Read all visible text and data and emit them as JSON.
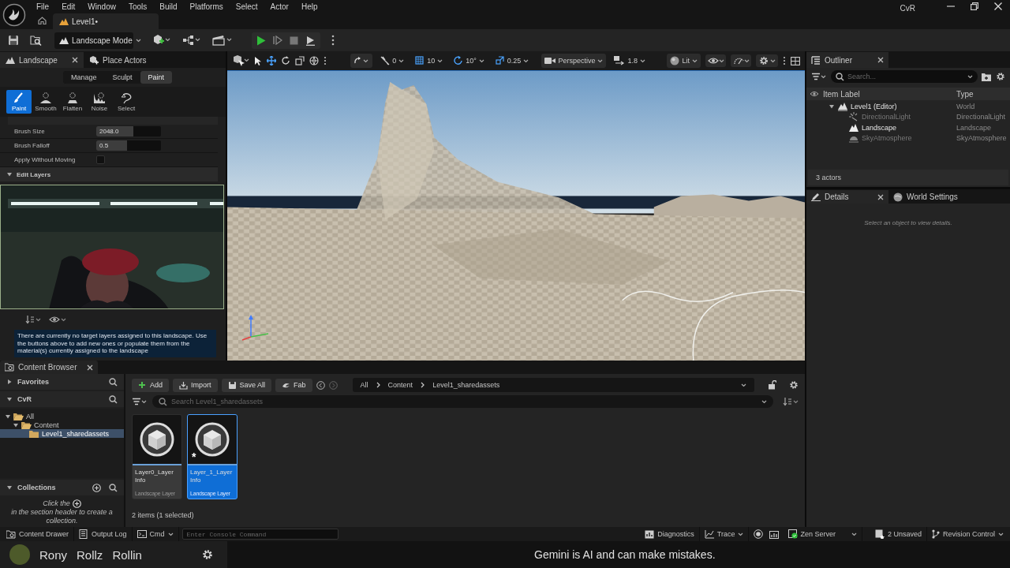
{
  "menu": [
    "File",
    "Edit",
    "Window",
    "Tools",
    "Build",
    "Platforms",
    "Select",
    "Actor",
    "Help"
  ],
  "project_name": "CvR",
  "level_tab": {
    "label": "Level1•",
    "selected": true
  },
  "toolbar": {
    "mode_dropdown": "Landscape Mode"
  },
  "landscape_panel": {
    "tabs": [
      {
        "label": "Landscape",
        "selected": true
      },
      {
        "label": "Place Actors",
        "selected": false
      }
    ],
    "modes": [
      {
        "label": "Manage",
        "selected": false
      },
      {
        "label": "Sculpt",
        "selected": false
      },
      {
        "label": "Paint",
        "selected": true
      }
    ],
    "tools": [
      {
        "label": "Paint",
        "selected": true
      },
      {
        "label": "Smooth",
        "selected": false
      },
      {
        "label": "Flatten",
        "selected": false
      },
      {
        "label": "Noise",
        "selected": false
      },
      {
        "label": "Select",
        "selected": false
      }
    ],
    "properties": [
      {
        "kind": "slider",
        "label": "Brush Size",
        "value": "2048.0",
        "level": 0.57
      },
      {
        "kind": "slider",
        "label": "Brush Falloff",
        "value": "0.5",
        "level": 0.48
      },
      {
        "kind": "checkbox",
        "label": "Apply Without Moving",
        "checked": false
      }
    ],
    "section": {
      "label": "Edit Layers",
      "expanded": true
    },
    "notice": "There are currently no target layers assigned to this landscape. Use the buttons above to add new ones or populate them from the material(s) currently assigned to the landscape"
  },
  "viewport": {
    "snap_values": [
      "0",
      "10",
      "10°",
      "0.25"
    ],
    "camera": "Perspective",
    "speed": "1.8",
    "view_mode": "Lit"
  },
  "outliner": {
    "tab": "Outliner",
    "search_placeholder": "Search...",
    "columns": [
      "Item Label",
      "Type"
    ],
    "rows": [
      {
        "label": "Level1 (Editor)",
        "type": "World",
        "kind": "world",
        "dimmed": false,
        "expanded": true,
        "children": [
          {
            "label": "DirectionalLight",
            "type": "DirectionalLight",
            "kind": "light",
            "dimmed": true
          },
          {
            "label": "Landscape",
            "type": "Landscape",
            "kind": "landscape",
            "dimmed": false
          },
          {
            "label": "SkyAtmosphere",
            "type": "SkyAtmosphere",
            "kind": "sky",
            "dimmed": true
          }
        ]
      }
    ],
    "footer": "3 actors"
  },
  "details": {
    "tabs": [
      {
        "label": "Details",
        "selected": true
      },
      {
        "label": "World Settings",
        "selected": false
      }
    ],
    "empty_message": "Select an object to view details."
  },
  "content_browser": {
    "tab": "Content Browser",
    "actions": [
      "Add",
      "Import",
      "Save All",
      "Fab"
    ],
    "breadcrumb": [
      "All",
      "Content",
      "Level1_sharedassets"
    ],
    "search_placeholder": "Search Level1_sharedassets",
    "sources": [
      {
        "label": "Favorites",
        "expanded": false
      },
      {
        "label": "CvR",
        "expanded": true
      }
    ],
    "folders": [
      {
        "label": "All",
        "expanded": true,
        "selected": false,
        "children": [
          {
            "label": "Content",
            "expanded": true,
            "selected": false,
            "children": [
              {
                "label": "Level1_sharedassets",
                "selected": true
              }
            ]
          }
        ]
      }
    ],
    "collections": {
      "label": "Collections",
      "expanded": true,
      "hint_start": "Click the",
      "hint_end": "in the section header to create a collection."
    },
    "assets": [
      {
        "name": "Layer0_Layer Info",
        "type": "Landscape Layer",
        "selected": false
      },
      {
        "name": "Layer_1_Layer Info",
        "type": "Landscape Layer",
        "selected": true,
        "badge": "*"
      }
    ],
    "status": "2 items (1 selected)"
  },
  "status_bar": {
    "left_buttons": [
      "Content Drawer",
      "Output Log"
    ],
    "cmd": "Cmd",
    "console_placeholder": "Enter Console Command",
    "diagnostics": "Diagnostics",
    "trace": "Trace",
    "zen": "Zen Server",
    "unsaved": "2 Unsaved",
    "revision": "Revision Control"
  },
  "overlay": {
    "names": [
      "Rony",
      "Rollz",
      "Rollin"
    ],
    "caption": "Gemini is AI and can make mistakes."
  }
}
